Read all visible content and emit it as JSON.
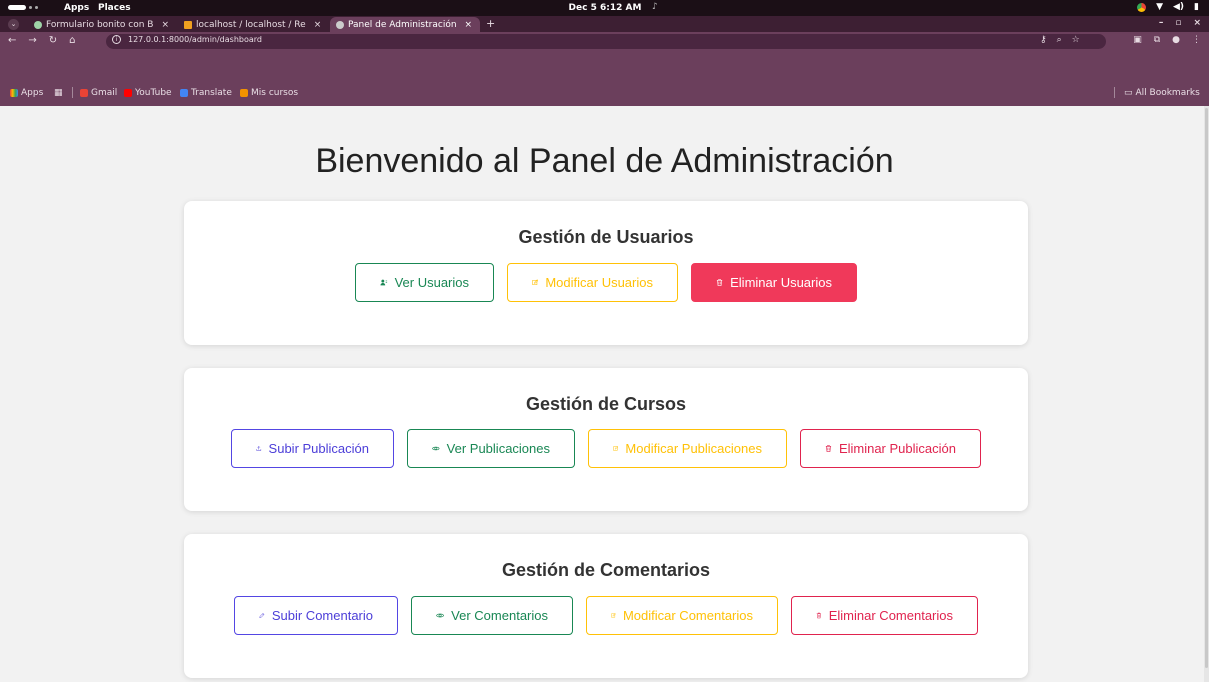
{
  "os_bar": {
    "apps": "Apps",
    "places": "Places",
    "clock": "Dec 5  6:12 AM"
  },
  "browser": {
    "tabs": [
      {
        "title": "Formulario bonito con B",
        "active": false
      },
      {
        "title": "localhost / localhost / Re",
        "active": false
      },
      {
        "title": "Panel de Administración",
        "active": true
      }
    ],
    "url": "127.0.0.1:8000/admin/dashboard",
    "bookmarks": [
      {
        "label": "Apps"
      },
      {
        "label": "Gmail"
      },
      {
        "label": "YouTube"
      },
      {
        "label": "Translate"
      },
      {
        "label": "Mis cursos"
      }
    ],
    "all_bookmarks": "All Bookmarks"
  },
  "page": {
    "title": "Bienvenido al Panel de Administración",
    "sections": [
      {
        "heading": "Gestión de Usuarios",
        "buttons": [
          {
            "label": "Ver Usuarios",
            "icon": "users-icon",
            "style": "green"
          },
          {
            "label": "Modificar Usuarios",
            "icon": "edit-icon",
            "style": "yellow"
          },
          {
            "label": "Eliminar Usuarios",
            "icon": "trash-icon",
            "style": "red-solid"
          }
        ]
      },
      {
        "heading": "Gestión de Cursos",
        "buttons": [
          {
            "label": "Subir Publicación",
            "icon": "upload-icon",
            "style": "indigo"
          },
          {
            "label": "Ver Publicaciones",
            "icon": "eye-icon",
            "style": "green"
          },
          {
            "label": "Modificar Publicaciones",
            "icon": "edit-icon",
            "style": "yellow"
          },
          {
            "label": "Eliminar Publicación",
            "icon": "trash-icon",
            "style": "crimson"
          }
        ]
      },
      {
        "heading": "Gestión de Comentarios",
        "buttons": [
          {
            "label": "Subir Comentario",
            "icon": "pencil-icon",
            "style": "indigo"
          },
          {
            "label": "Ver Comentarios",
            "icon": "eye-icon",
            "style": "green"
          },
          {
            "label": "Modificar Comentarios",
            "icon": "edit-icon",
            "style": "yellow"
          },
          {
            "label": "Eliminar Comentarios",
            "icon": "trash-icon",
            "style": "crimson"
          }
        ]
      }
    ]
  },
  "colors": {
    "green": "#198754",
    "yellow": "#ffc107",
    "red_solid": "#f0395a",
    "indigo": "#5346e3",
    "crimson": "#e0234e",
    "browser_chrome": "#6b3f5c"
  }
}
